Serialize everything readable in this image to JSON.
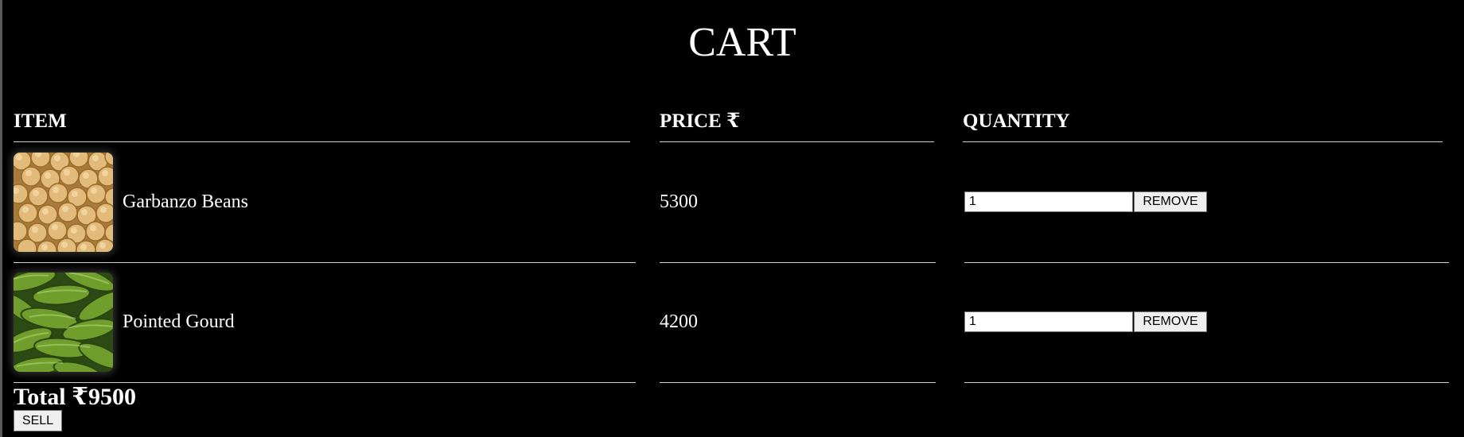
{
  "page": {
    "title": "CART",
    "background_color": "#000000",
    "text_color": "#ffffff"
  },
  "columns": {
    "item": "ITEM",
    "price": "PRICE ₹",
    "quantity": "QUANTITY"
  },
  "items": [
    {
      "name": "Garbanzo Beans",
      "price": "5300",
      "quantity": "1",
      "remove_label": "REMOVE",
      "image": "chickpeas-image"
    },
    {
      "name": "Pointed Gourd",
      "price": "4200",
      "quantity": "1",
      "remove_label": "REMOVE",
      "image": "pointed-gourd-image"
    }
  ],
  "total": {
    "label": "Total",
    "amount": "₹9500"
  },
  "sell_label": "SELL"
}
